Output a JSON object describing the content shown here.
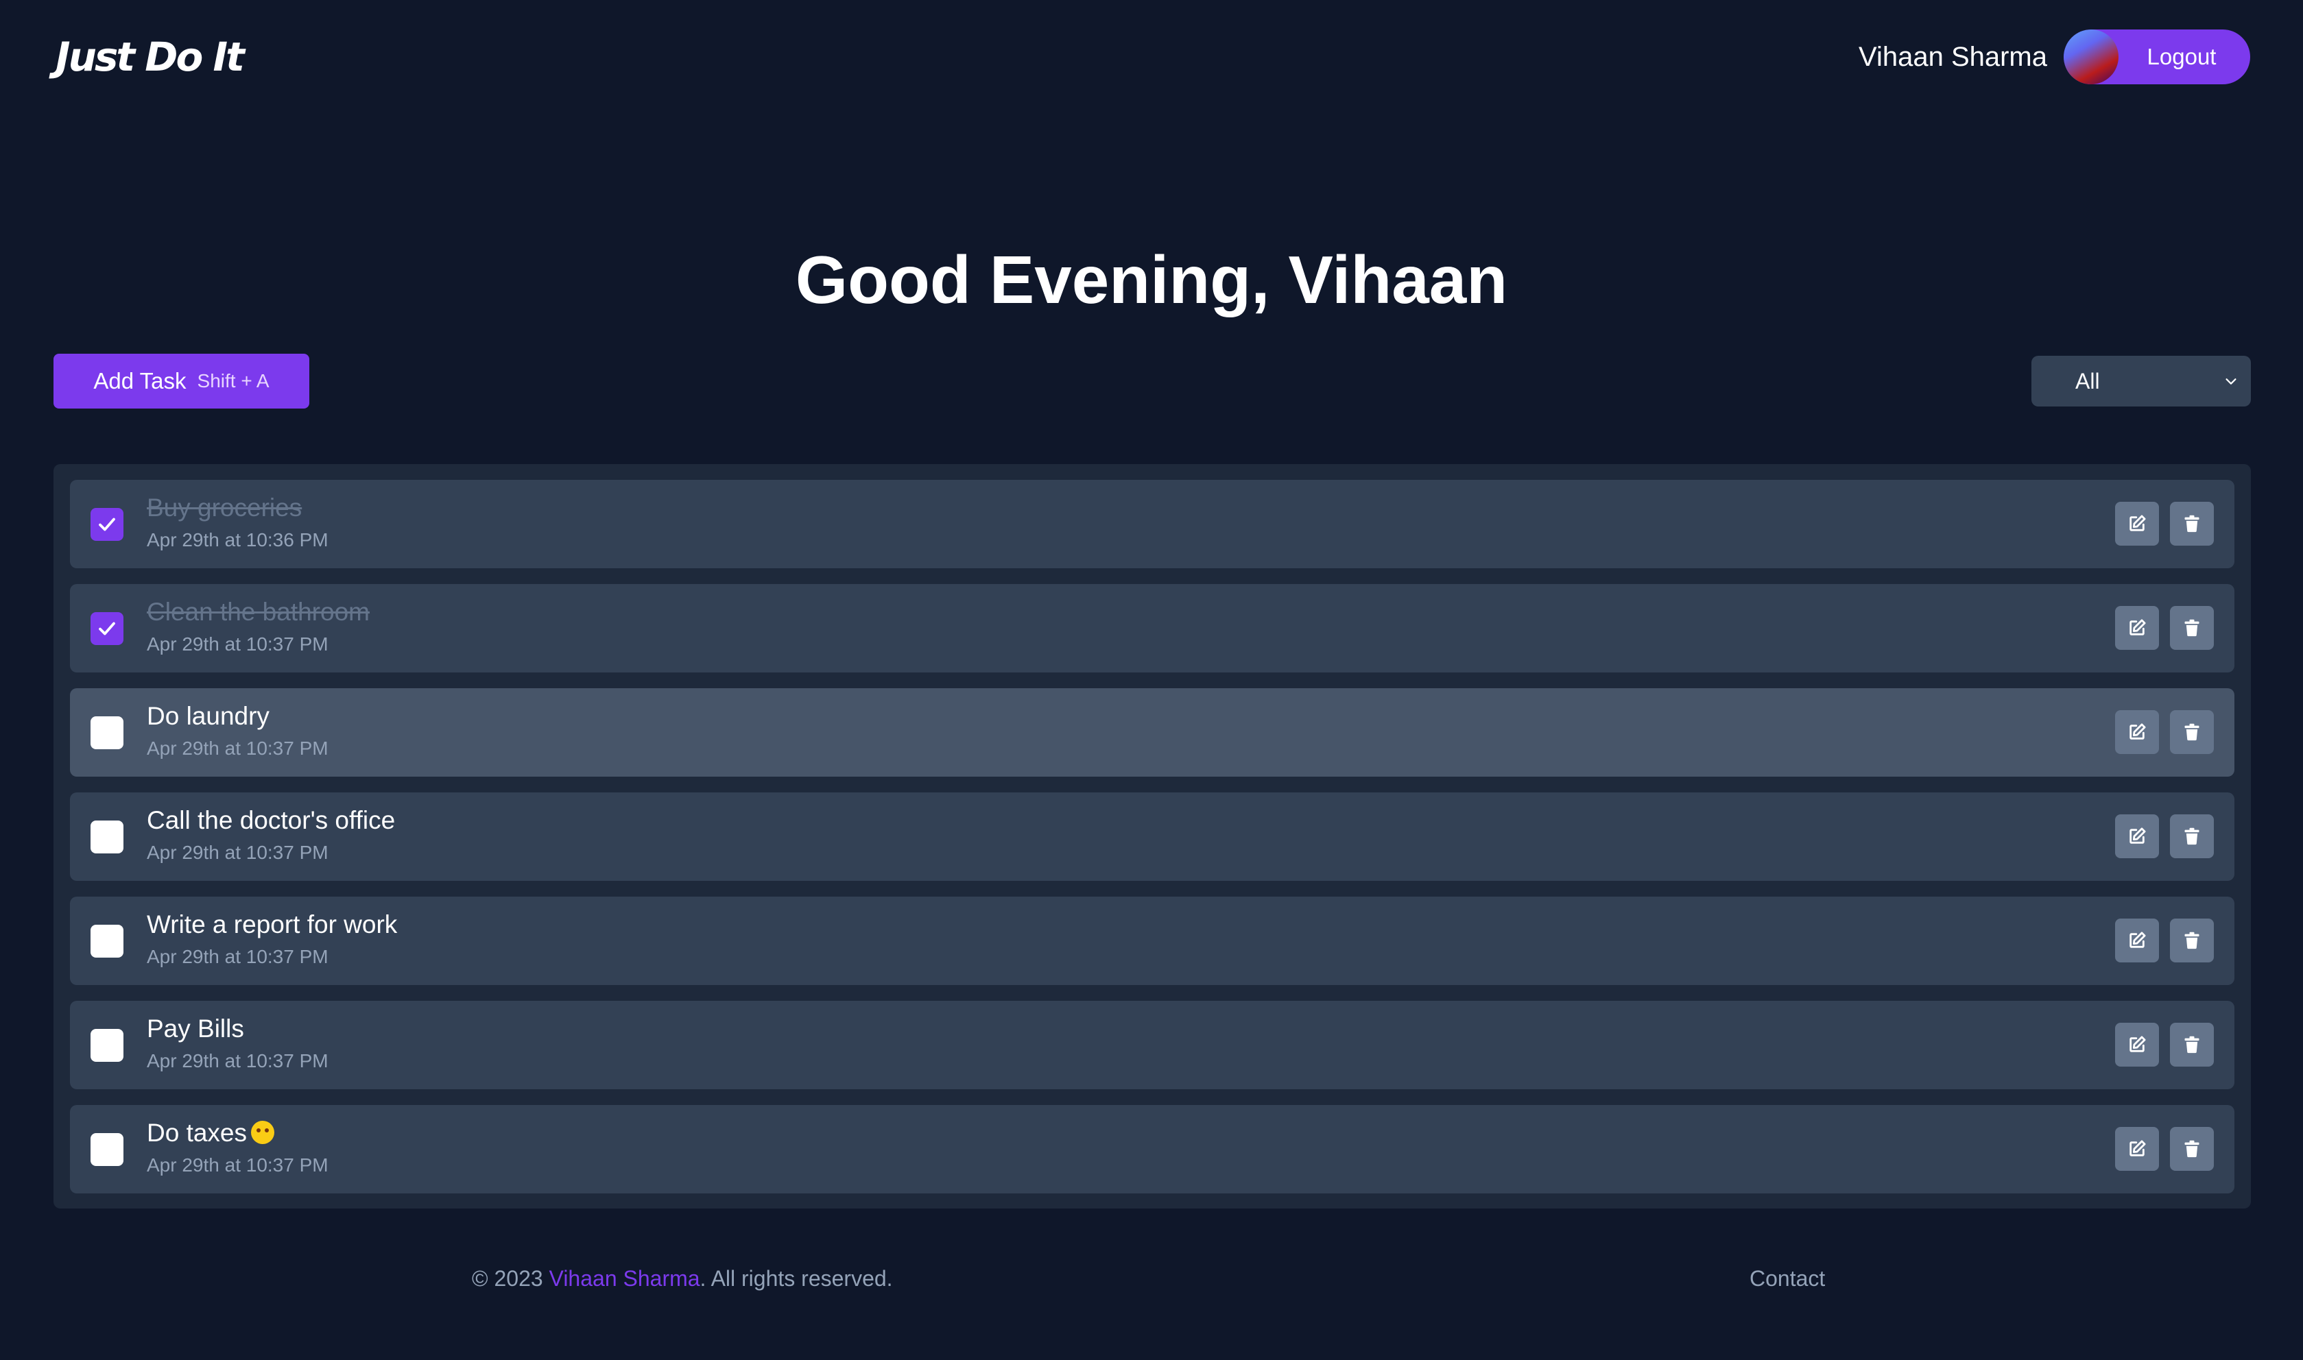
{
  "header": {
    "logo": "Just Do It",
    "user_name": "Vihaan Sharma",
    "logout_label": "Logout"
  },
  "greeting": "Good Evening, Vihaan",
  "toolbar": {
    "add_task_label": "Add Task",
    "add_task_shortcut": "Shift + A",
    "filter_value": "All"
  },
  "tasks": [
    {
      "title": "Buy groceries",
      "date": "Apr 29th at 10:36 PM",
      "completed": true
    },
    {
      "title": "Clean the bathroom",
      "date": "Apr 29th at 10:37 PM",
      "completed": true
    },
    {
      "title": "Do laundry",
      "date": "Apr 29th at 10:37 PM",
      "completed": false
    },
    {
      "title": "Call the doctor's office",
      "date": "Apr 29th at 10:37 PM",
      "completed": false
    },
    {
      "title": "Write a report for work",
      "date": "Apr 29th at 10:37 PM",
      "completed": false
    },
    {
      "title": "Pay Bills",
      "date": "Apr 29th at 10:37 PM",
      "completed": false
    },
    {
      "title": "Do taxes",
      "date": "Apr 29th at 10:37 PM",
      "completed": false,
      "emoji": "tired-face"
    }
  ],
  "footer": {
    "copyright_prefix": "© 2023",
    "copyright_name": "Vihaan Sharma",
    "copyright_suffix": ". All rights reserved.",
    "contact_label": "Contact"
  },
  "colors": {
    "background": "#0f172a",
    "accent": "#7c3aed",
    "task_bg": "#334155",
    "task_hover_bg": "#475569",
    "container_bg": "#1e293b"
  }
}
